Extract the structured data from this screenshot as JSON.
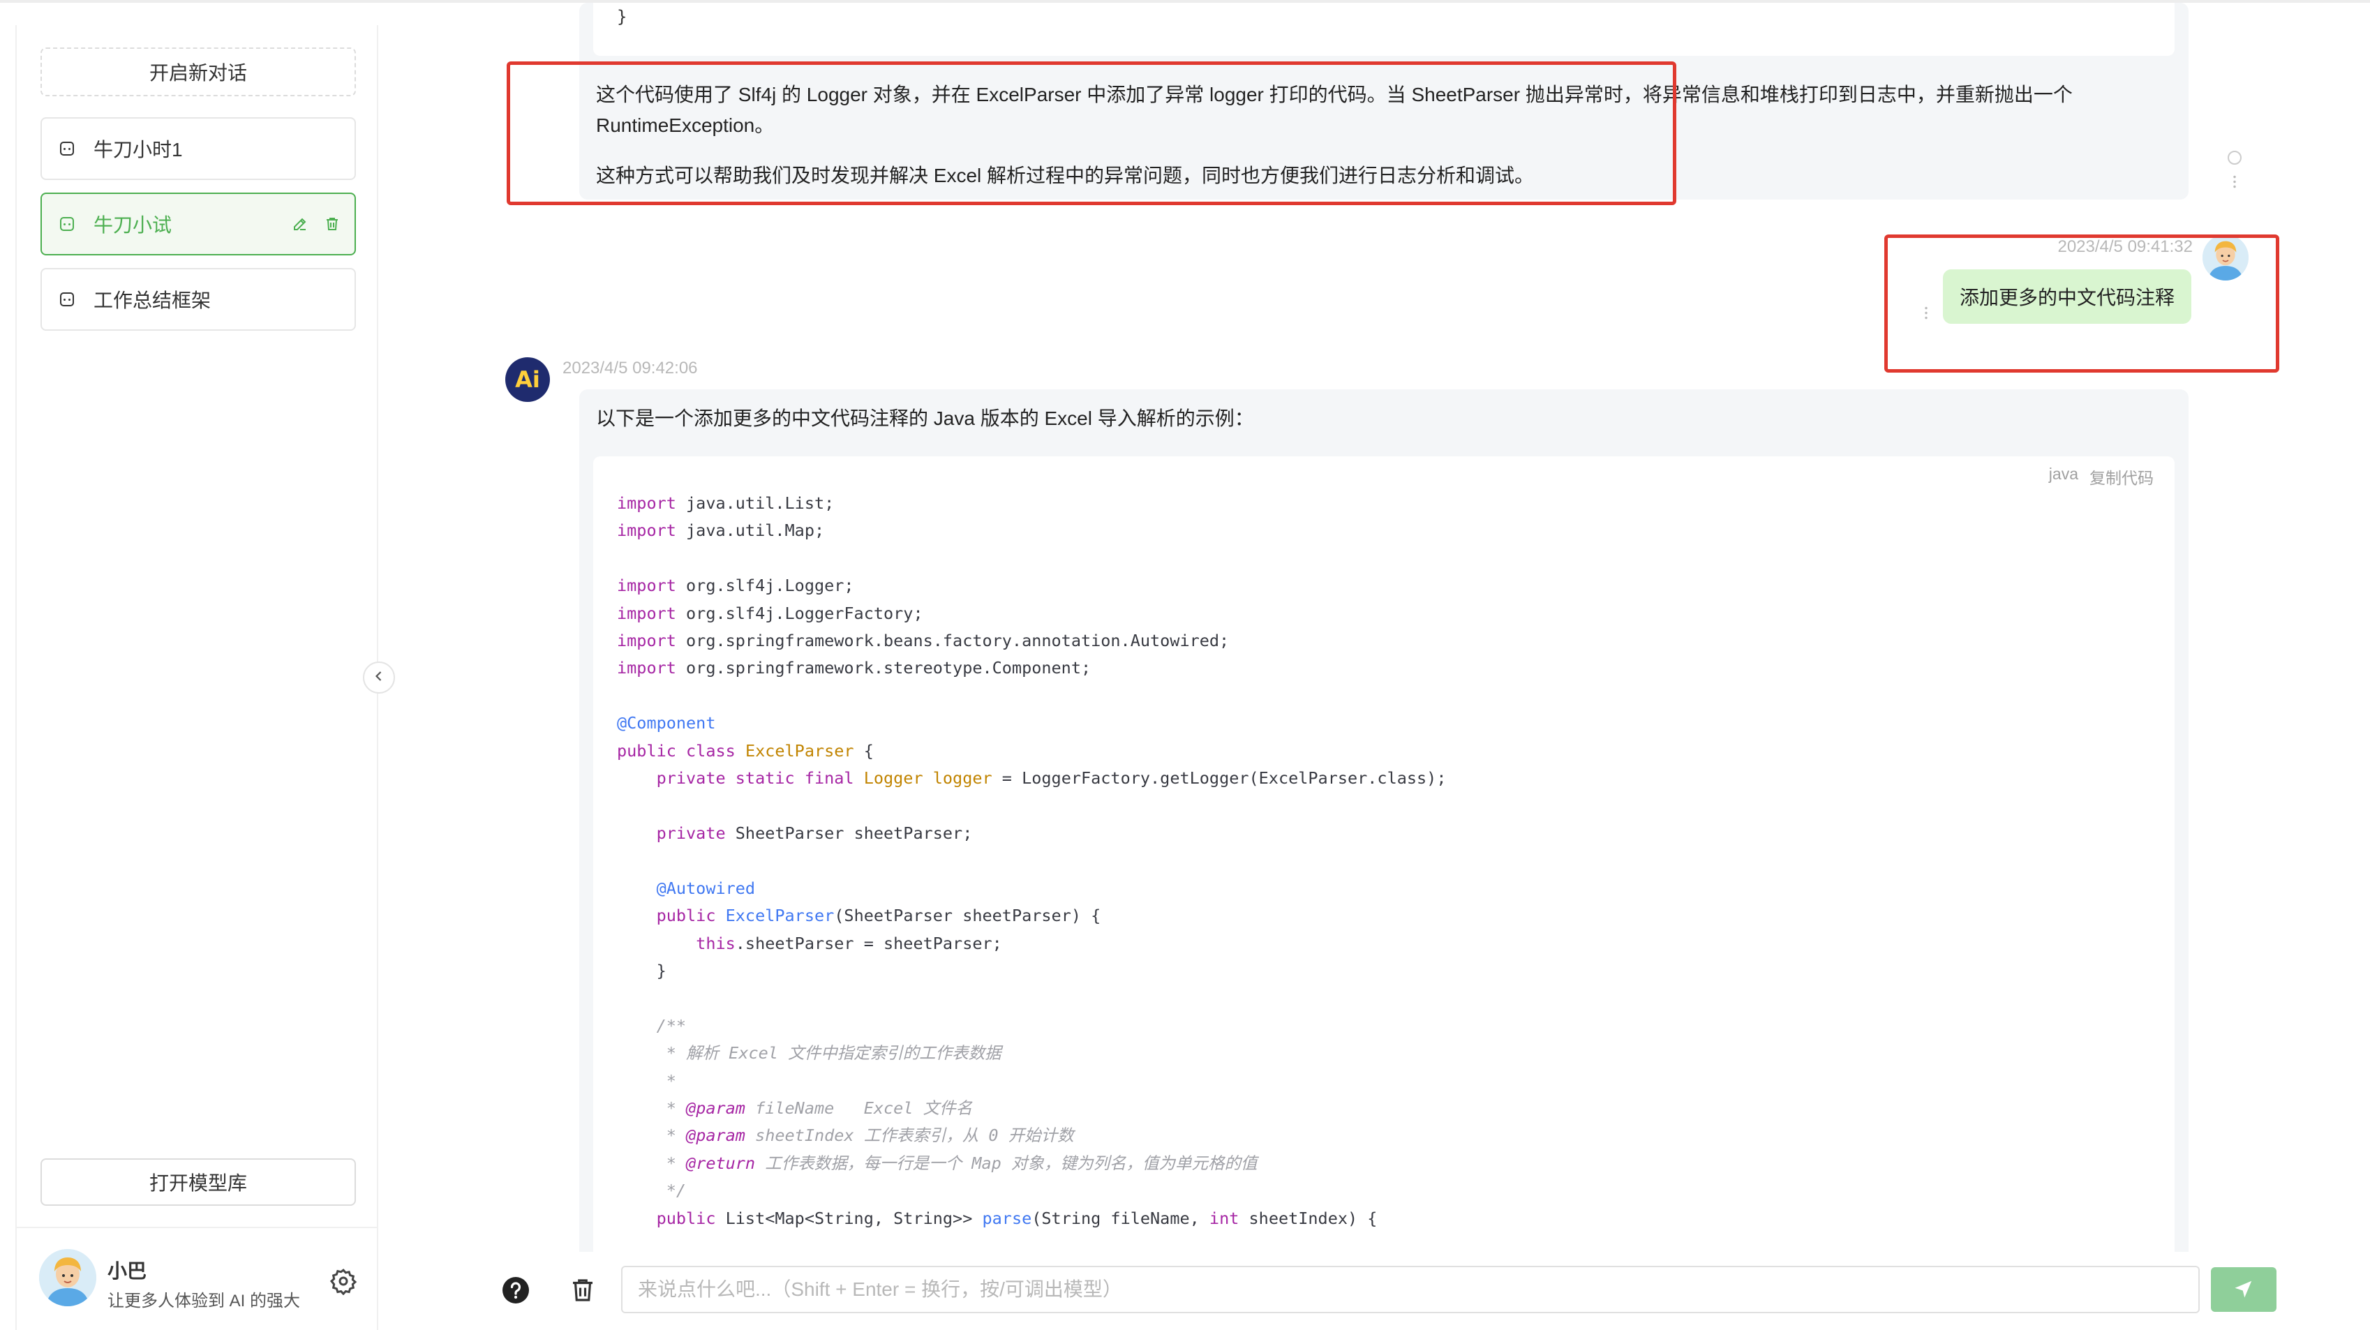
{
  "sidebar": {
    "new_chat_label": "开启新对话",
    "conversations": [
      {
        "label": "牛刀小时1",
        "active": false
      },
      {
        "label": "牛刀小试",
        "active": true
      },
      {
        "label": "工作总结框架",
        "active": false
      }
    ],
    "open_model_label": "打开模型库",
    "user": {
      "name": "小巴",
      "subtitle": "让更多人体验到 AI 的强大"
    }
  },
  "messages": {
    "prev_ai": {
      "code_tail": "}",
      "paragraph1_line1": "这个代码使用了 Slf4j 的 Logger 对象，并在 ExcelParser 中添加了异常 logger 打印的代码。当 SheetParser 抛出异常时，将异常信息和堆栈打印到日志中，并重新抛出一个",
      "paragraph1_line2": "RuntimeException。",
      "paragraph2": "这种方式可以帮助我们及时发现并解决 Excel 解析过程中的异常问题，同时也方便我们进行日志分析和调试。"
    },
    "user_msg": {
      "time": "2023/4/5 09:41:32",
      "text": "添加更多的中文代码注释"
    },
    "ai_msg": {
      "avatar_text": "Ai",
      "time": "2023/4/5 09:42:06",
      "intro": "以下是一个添加更多的中文代码注释的 Java 版本的 Excel 导入解析的示例：",
      "code_lang": "java",
      "copy_label": "复制代码"
    }
  },
  "input": {
    "placeholder": "来说点什么吧...（Shift + Enter = 换行，按/可调出模型）",
    "value": ""
  },
  "colors": {
    "accent_green": "#4caf50",
    "user_bubble": "#d9f5d0",
    "highlight_red": "#e0392f",
    "send_button": "#8fcf9a"
  },
  "icons": [
    "chat-icon",
    "edit-icon",
    "delete-icon",
    "gear-icon",
    "chevron-left-icon",
    "help-icon",
    "trash-icon",
    "send-icon",
    "more-vertical-icon",
    "refresh-icon"
  ]
}
